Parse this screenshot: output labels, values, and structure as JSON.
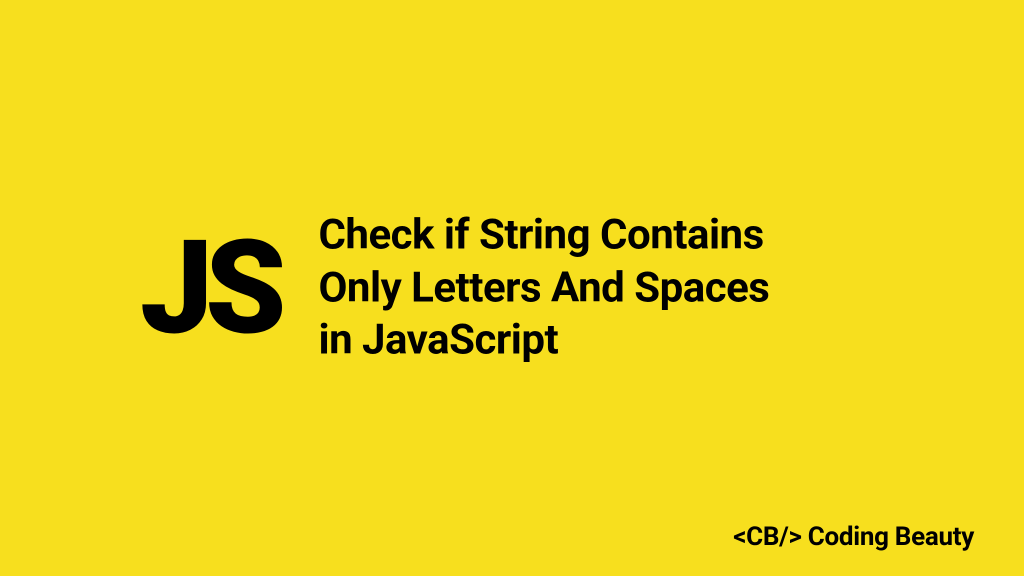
{
  "logo": {
    "text": "JS"
  },
  "headline": {
    "line1": "Check if String Contains",
    "line2": "Only Letters And Spaces",
    "line3": "in JavaScript"
  },
  "footer": {
    "brand_text": "<CB/> Coding Beauty"
  },
  "colors": {
    "background": "#f7df1e",
    "text": "#000000"
  }
}
